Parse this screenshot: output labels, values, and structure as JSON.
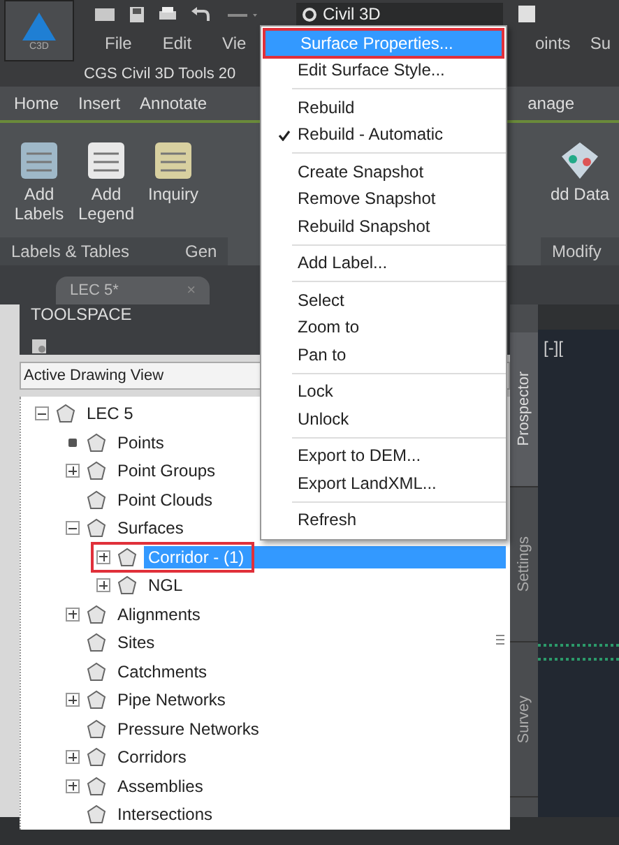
{
  "app_button": {
    "label": "C3D"
  },
  "workspace": {
    "label": "Civil 3D"
  },
  "menu_bar": [
    "File",
    "Edit",
    "Vie",
    "oints",
    "Su"
  ],
  "toolbar_title": "CGS Civil 3D Tools 20",
  "ribbon_tabs": [
    {
      "label": "Home"
    },
    {
      "label": "Insert"
    },
    {
      "label": "Annotate"
    },
    {
      "label": "anage"
    }
  ],
  "ribbon_left": {
    "buttons": [
      {
        "label": "Add Labels",
        "kind": "tag"
      },
      {
        "label": "Add Legend",
        "kind": "table"
      },
      {
        "label": "Inquiry",
        "kind": "report"
      }
    ],
    "panel_labels": [
      "Labels & Tables",
      "Gen"
    ]
  },
  "ribbon_right": {
    "buttons": [
      {
        "label": "dd Data",
        "kind": "data"
      }
    ],
    "panel_labels": [
      "Modify"
    ]
  },
  "document_tab": {
    "label": "LEC 5*",
    "close": "×"
  },
  "toolspace": {
    "title": "TOOLSPACE",
    "view": "Active Drawing View"
  },
  "tree": {
    "items": [
      {
        "label": "LEC 5",
        "expanded": true,
        "selected": false,
        "highlighted": false,
        "children": [
          {
            "label": "Points",
            "pending": true,
            "selected": false,
            "highlighted": false
          },
          {
            "label": "Point Groups",
            "expanded": false,
            "selected": false,
            "highlighted": false
          },
          {
            "label": "Point Clouds",
            "selected": false,
            "highlighted": false
          },
          {
            "label": "Surfaces",
            "expanded": true,
            "selected": false,
            "highlighted": false,
            "children": [
              {
                "label": "Corridor - (1)",
                "expanded": false,
                "selected": true,
                "highlighted": true
              },
              {
                "label": "NGL",
                "expanded": false,
                "selected": false,
                "highlighted": false
              }
            ]
          },
          {
            "label": "Alignments",
            "expanded": false,
            "selected": false,
            "highlighted": false
          },
          {
            "label": "Sites",
            "selected": false,
            "highlighted": false
          },
          {
            "label": "Catchments",
            "selected": false,
            "highlighted": false
          },
          {
            "label": "Pipe Networks",
            "expanded": false,
            "selected": false,
            "highlighted": false
          },
          {
            "label": "Pressure Networks",
            "selected": false,
            "highlighted": false
          },
          {
            "label": "Corridors",
            "expanded": false,
            "selected": false,
            "highlighted": false
          },
          {
            "label": "Assemblies",
            "expanded": false,
            "selected": false,
            "highlighted": false
          },
          {
            "label": "Intersections",
            "selected": false,
            "highlighted": false
          }
        ]
      }
    ]
  },
  "side_tabs": [
    {
      "label": "Prospector",
      "selected": true
    },
    {
      "label": "Settings",
      "selected": false
    },
    {
      "label": "Survey",
      "selected": false
    }
  ],
  "viewport": {
    "label": "[-]["
  },
  "context_menu": {
    "groups": [
      [
        {
          "label": "Surface Properties...",
          "selected": true,
          "checked": false,
          "highlighted": true
        },
        {
          "label": "Edit Surface Style...",
          "selected": false,
          "checked": false,
          "highlighted": false
        }
      ],
      [
        {
          "label": "Rebuild",
          "selected": false,
          "checked": false,
          "highlighted": false
        },
        {
          "label": "Rebuild - Automatic",
          "selected": false,
          "checked": true,
          "highlighted": false
        }
      ],
      [
        {
          "label": "Create Snapshot",
          "selected": false,
          "checked": false,
          "highlighted": false
        },
        {
          "label": "Remove Snapshot",
          "selected": false,
          "checked": false,
          "highlighted": false
        },
        {
          "label": "Rebuild Snapshot",
          "selected": false,
          "checked": false,
          "highlighted": false
        }
      ],
      [
        {
          "label": "Add Label...",
          "selected": false,
          "checked": false,
          "highlighted": false
        }
      ],
      [
        {
          "label": "Select",
          "selected": false,
          "checked": false,
          "highlighted": false
        },
        {
          "label": "Zoom to",
          "selected": false,
          "checked": false,
          "highlighted": false
        },
        {
          "label": "Pan to",
          "selected": false,
          "checked": false,
          "highlighted": false
        }
      ],
      [
        {
          "label": "Lock",
          "selected": false,
          "checked": false,
          "highlighted": false
        },
        {
          "label": "Unlock",
          "selected": false,
          "checked": false,
          "highlighted": false
        }
      ],
      [
        {
          "label": "Export to DEM...",
          "selected": false,
          "checked": false,
          "highlighted": false
        },
        {
          "label": "Export LandXML...",
          "selected": false,
          "checked": false,
          "highlighted": false
        }
      ],
      [
        {
          "label": "Refresh",
          "selected": false,
          "checked": false,
          "highlighted": false
        }
      ]
    ]
  }
}
